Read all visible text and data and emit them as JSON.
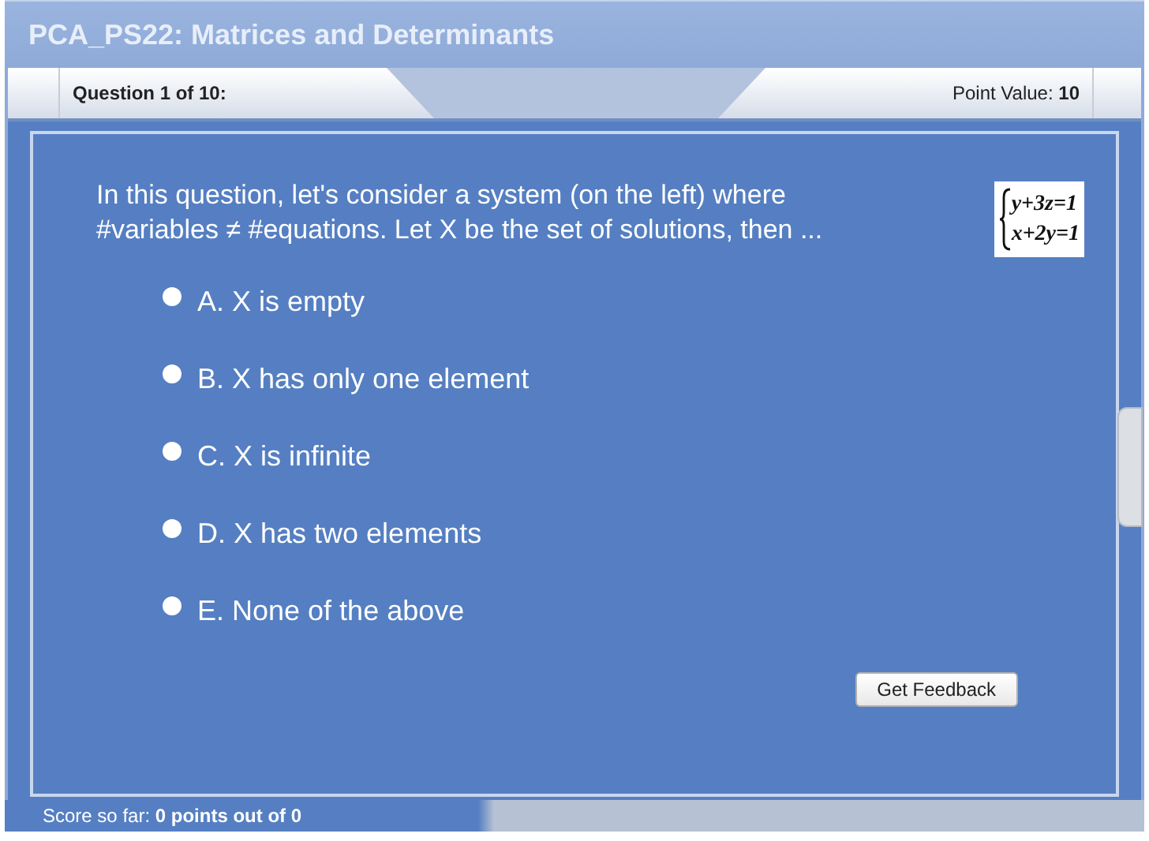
{
  "window": {
    "title": "PCA_PS22: Matrices and Determinants"
  },
  "header": {
    "question_counter": "Question 1 of 10:",
    "point_value": "Point Value: **10**"
  },
  "question": {
    "text": "In this question, let's consider a system (on the left) where #variables ≠ #equations. Let X be the set of solutions, then ...",
    "equations": [
      "y+3z=1",
      "x+2y=1"
    ]
  },
  "options": [
    {
      "label": "A. X is empty",
      "selected": false
    },
    {
      "label": "B. X has only one element",
      "selected": false
    },
    {
      "label": "C. X is infinite",
      "selected": false
    },
    {
      "label": "D. X has two elements",
      "selected": false
    },
    {
      "label": "E. None of the above",
      "selected": false
    }
  ],
  "buttons": [
    "Get Feedback"
  ],
  "status_bar": {
    "score": "Score so far: **0 points out of 0**"
  }
}
